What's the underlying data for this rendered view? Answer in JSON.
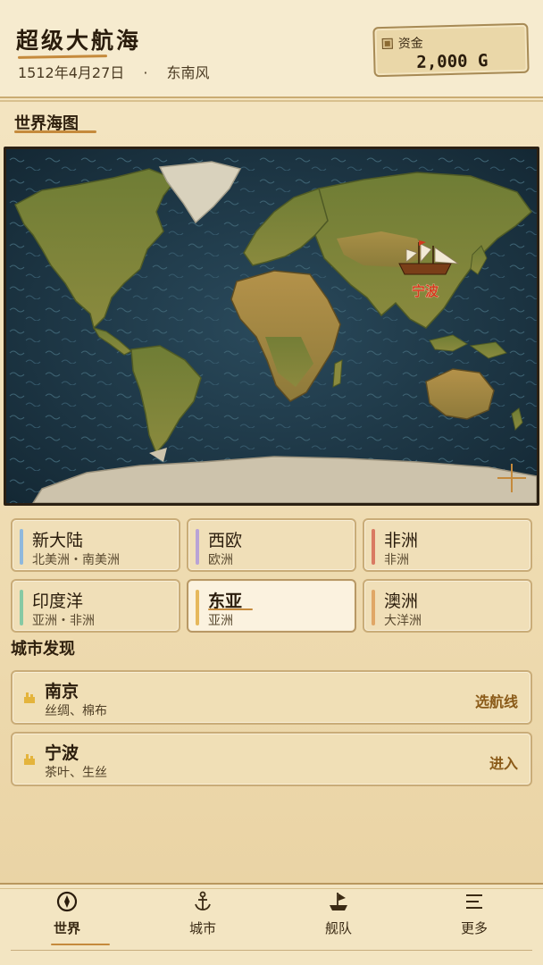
{
  "header": {
    "title": "超级大航海",
    "date": "1512年4月27日",
    "separator": "·",
    "wind": "东南风",
    "funds_label": "资金",
    "funds_value": "2,000 G"
  },
  "map": {
    "title": "世界海图",
    "marker_city": "宁波"
  },
  "regions": [
    {
      "name": "新大陆",
      "sub": "北美洲・南美洲",
      "color": "#8fb8dc",
      "selected": false
    },
    {
      "name": "西欧",
      "sub": "欧洲",
      "color": "#b9a3d6",
      "selected": false
    },
    {
      "name": "非洲",
      "sub": "非洲",
      "color": "#d97a62",
      "selected": false
    },
    {
      "name": "印度洋",
      "sub": "亚洲・非洲",
      "color": "#86c9a4",
      "selected": false
    },
    {
      "name": "东亚",
      "sub": "亚洲",
      "color": "#e6b85c",
      "selected": true
    },
    {
      "name": "澳洲",
      "sub": "大洋洲",
      "color": "#e0a766",
      "selected": false
    }
  ],
  "cities_section": {
    "title": "城市发现"
  },
  "cities": [
    {
      "name": "南京",
      "goods": "丝绸、棉布",
      "action": "选航线"
    },
    {
      "name": "宁波",
      "goods": "茶叶、生丝",
      "action": "进入"
    }
  ],
  "nav": [
    {
      "label": "世界",
      "icon": "compass-icon",
      "active": true
    },
    {
      "label": "城市",
      "icon": "anchor-icon",
      "active": false
    },
    {
      "label": "舰队",
      "icon": "ship-icon",
      "active": false
    },
    {
      "label": "更多",
      "icon": "menu-icon",
      "active": false
    }
  ],
  "colors": {
    "accent": "#c58a3c",
    "parchment": "#f0dfb8",
    "ocean": "#1e3a4a",
    "land": "#7c8a3a",
    "marker": "#d23a1e"
  }
}
